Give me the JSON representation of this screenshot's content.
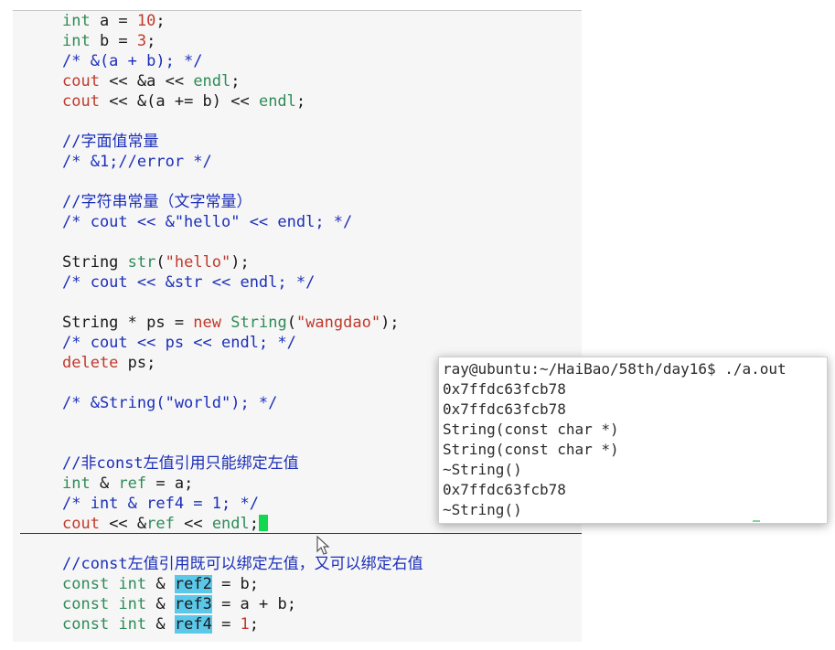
{
  "code_lines": [
    {
      "segs": [
        {
          "t": "int",
          "c": "kw"
        },
        {
          "t": " a = "
        },
        {
          "t": "10",
          "c": "num"
        },
        {
          "t": ";"
        }
      ]
    },
    {
      "segs": [
        {
          "t": "int",
          "c": "kw"
        },
        {
          "t": " b = "
        },
        {
          "t": "3",
          "c": "num"
        },
        {
          "t": ";"
        }
      ]
    },
    {
      "segs": [
        {
          "t": "/* &(a + b); */",
          "c": "cm"
        }
      ]
    },
    {
      "segs": [
        {
          "t": "cout",
          "c": "red"
        },
        {
          "t": " << &a << "
        },
        {
          "t": "endl",
          "c": "fn"
        },
        {
          "t": ";"
        }
      ]
    },
    {
      "segs": [
        {
          "t": "cout",
          "c": "red"
        },
        {
          "t": " << &(a += b) << "
        },
        {
          "t": "endl",
          "c": "fn"
        },
        {
          "t": ";"
        }
      ]
    },
    {
      "segs": []
    },
    {
      "segs": [
        {
          "t": "//字面值常量",
          "c": "cm"
        }
      ]
    },
    {
      "segs": [
        {
          "t": "/* &1;//error */",
          "c": "cm"
        }
      ]
    },
    {
      "segs": []
    },
    {
      "segs": [
        {
          "t": "//字符串常量（文字常量）",
          "c": "cm"
        }
      ]
    },
    {
      "segs": [
        {
          "t": "/* cout << &\"hello\" << endl; */",
          "c": "cm"
        }
      ]
    },
    {
      "segs": []
    },
    {
      "segs": [
        {
          "t": "String "
        },
        {
          "t": "str",
          "c": "fn"
        },
        {
          "t": "("
        },
        {
          "t": "\"hello\"",
          "c": "str"
        },
        {
          "t": ");"
        }
      ]
    },
    {
      "segs": [
        {
          "t": "/* cout << &str << endl; */",
          "c": "cm"
        }
      ]
    },
    {
      "segs": []
    },
    {
      "segs": [
        {
          "t": "String * ps = "
        },
        {
          "t": "new",
          "c": "red"
        },
        {
          "t": " "
        },
        {
          "t": "String",
          "c": "fn"
        },
        {
          "t": "("
        },
        {
          "t": "\"wangdao\"",
          "c": "str"
        },
        {
          "t": ");"
        }
      ]
    },
    {
      "segs": [
        {
          "t": "/* cout << ps << endl; */",
          "c": "cm"
        }
      ]
    },
    {
      "segs": [
        {
          "t": "delete",
          "c": "red"
        },
        {
          "t": " ps;"
        }
      ]
    },
    {
      "segs": []
    },
    {
      "segs": [
        {
          "t": "/* &String(\"world\"); */",
          "c": "cm"
        }
      ]
    },
    {
      "segs": []
    },
    {
      "segs": []
    },
    {
      "segs": [
        {
          "t": "//非const左值引用只能绑定左值",
          "c": "cm"
        }
      ]
    },
    {
      "segs": [
        {
          "t": "int",
          "c": "kw"
        },
        {
          "t": " & "
        },
        {
          "t": "ref",
          "c": "fn"
        },
        {
          "t": " = a;"
        }
      ]
    },
    {
      "segs": [
        {
          "t": "/* int & ref4 = 1; */",
          "c": "cm"
        }
      ]
    },
    {
      "segs": [
        {
          "t": "cout",
          "c": "red"
        },
        {
          "t": " << &"
        },
        {
          "t": "ref",
          "c": "fn"
        },
        {
          "t": " << "
        },
        {
          "t": "endl",
          "c": "fn"
        },
        {
          "t": ";"
        }
      ],
      "cursor": true
    },
    {
      "segs": []
    },
    {
      "segs": [
        {
          "t": "//const左值引用既可以绑定左值，又可以绑定右值",
          "c": "cm"
        }
      ]
    },
    {
      "segs": [
        {
          "t": "const",
          "c": "kw"
        },
        {
          "t": " "
        },
        {
          "t": "int",
          "c": "kw"
        },
        {
          "t": " & "
        },
        {
          "t": "ref2",
          "c": "hl"
        },
        {
          "t": " = b;"
        }
      ]
    },
    {
      "segs": [
        {
          "t": "const",
          "c": "kw"
        },
        {
          "t": " "
        },
        {
          "t": "int",
          "c": "kw"
        },
        {
          "t": " & "
        },
        {
          "t": "ref3",
          "c": "hl"
        },
        {
          "t": " = a + b;"
        }
      ]
    },
    {
      "segs": [
        {
          "t": "const",
          "c": "kw"
        },
        {
          "t": " "
        },
        {
          "t": "int",
          "c": "kw"
        },
        {
          "t": " & "
        },
        {
          "t": "ref4",
          "c": "hl"
        },
        {
          "t": " = "
        },
        {
          "t": "1",
          "c": "num"
        },
        {
          "t": ";"
        }
      ]
    }
  ],
  "terminal": {
    "lines": [
      "ray@ubuntu:~/HaiBao/58th/day16$ ./a.out",
      "0x7ffdc63fcb78",
      "0x7ffdc63fcb78",
      "String(const char *)",
      "String(const char *)",
      "~String()",
      "0x7ffdc63fcb78",
      "~String()"
    ]
  },
  "icons": {
    "mouse_pointer": "mouse-pointer-icon",
    "cursor": "text-cursor-icon"
  },
  "colors": {
    "keyword": "#2e8b57",
    "comment": "#1c2fb8",
    "literal": "#c0392b",
    "highlight": "#5bc8ea",
    "cursor": "#11d84e"
  }
}
